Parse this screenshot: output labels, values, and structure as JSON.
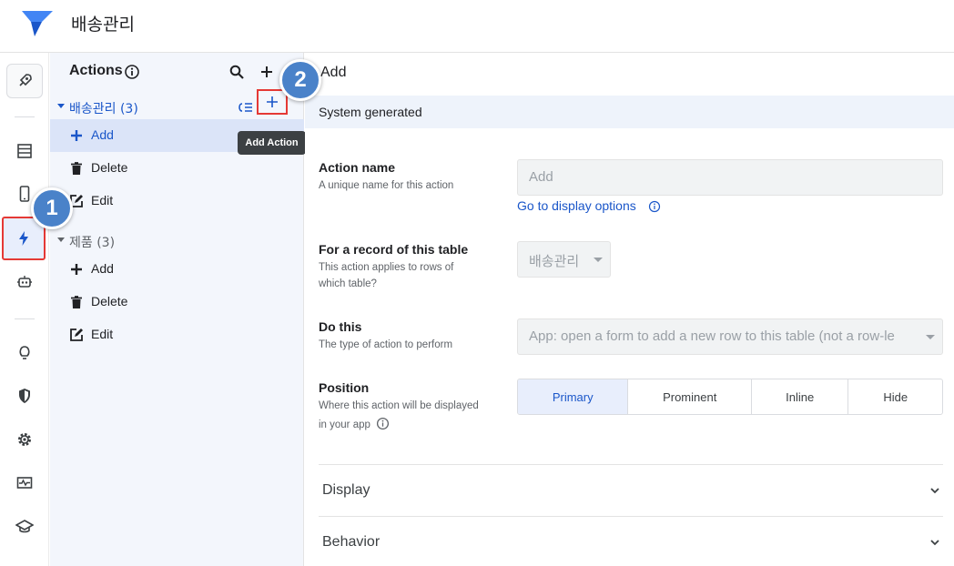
{
  "app": {
    "title": "배송관리"
  },
  "rail": {
    "items": [
      "rocket-icon",
      "table-icon",
      "phone-icon",
      "bolt-icon",
      "bot-icon",
      "bulb-icon",
      "shield-icon",
      "gear-icon",
      "monitor-icon",
      "school-icon"
    ],
    "active": "bolt-icon"
  },
  "panel": {
    "title": "Actions",
    "tooltip": "Add Action",
    "groups": [
      {
        "label": "배송관리 (3)",
        "items": [
          "Add",
          "Delete",
          "Edit"
        ]
      },
      {
        "label": "제품 (3)",
        "items": [
          "Add",
          "Delete",
          "Edit"
        ]
      }
    ]
  },
  "callouts": [
    "1",
    "2"
  ],
  "main": {
    "title": "Add",
    "banner": "System generated",
    "action_name": {
      "label": "Action name",
      "help": "A unique name for this action",
      "value": "Add",
      "link": "Go to display options"
    },
    "record": {
      "label": "For a record of this table",
      "help1": "This action applies to rows of",
      "help2": "which table?",
      "value": "배송관리"
    },
    "do_this": {
      "label": "Do this",
      "help": "The type of action to perform",
      "value": "App: open a form to add a new row to this table (not a row-le"
    },
    "position": {
      "label": "Position",
      "help1": "Where this action will be displayed",
      "help2": "in your app",
      "options": [
        "Primary",
        "Prominent",
        "Inline",
        "Hide"
      ],
      "selected": "Primary"
    },
    "sections": [
      "Display",
      "Behavior"
    ]
  },
  "colors": {
    "accent": "#1a56c9",
    "highlight": "#e53935",
    "callout": "#4a82c9",
    "panel_bg": "#f3f6fc"
  }
}
